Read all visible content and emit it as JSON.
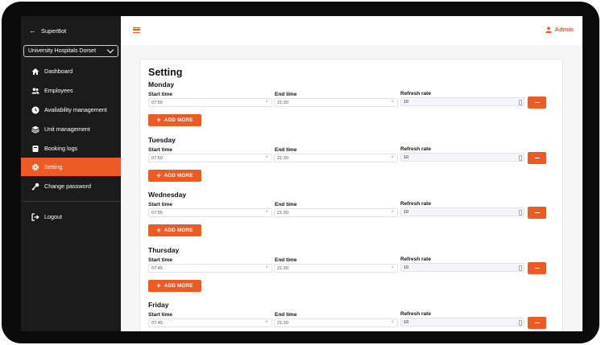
{
  "sidebar": {
    "back_label": "SuperBot",
    "org_select": "University Hospitals Dorset",
    "items": [
      {
        "label": "Dashboard",
        "icon": "home-icon"
      },
      {
        "label": "Employees",
        "icon": "users-icon"
      },
      {
        "label": "Availability management",
        "icon": "clock-icon"
      },
      {
        "label": "Unit management",
        "icon": "layers-icon"
      },
      {
        "label": "Booking logs",
        "icon": "book-icon"
      },
      {
        "label": "Setting",
        "icon": "gear-icon",
        "active": true
      },
      {
        "label": "Change password",
        "icon": "key-icon"
      }
    ],
    "logout_label": "Logout"
  },
  "topbar": {
    "menu_icon": "hamburger-icon",
    "user_label": "Admin",
    "user_icon": "user-icon"
  },
  "page": {
    "title": "Setting",
    "start_label": "Start time",
    "end_label": "End time",
    "rate_label": "Refresh rate",
    "add_more_label": "ADD MORE",
    "clear_glyph": "×"
  },
  "days": [
    {
      "name": "Monday",
      "start": "07:50",
      "end": "21:30",
      "rate": "10"
    },
    {
      "name": "Tuesday",
      "start": "07:50",
      "end": "21:30",
      "rate": "10"
    },
    {
      "name": "Wednesday",
      "start": "07:55",
      "end": "21:30",
      "rate": "10"
    },
    {
      "name": "Thursday",
      "start": "07:45",
      "end": "21:30",
      "rate": "10"
    },
    {
      "name": "Friday",
      "start": "07:45",
      "end": "21:30",
      "rate": "10"
    }
  ],
  "colors": {
    "accent": "#ee5a24",
    "sidebar_bg": "#1b1b1b",
    "content_bg": "#f6f6f6"
  }
}
